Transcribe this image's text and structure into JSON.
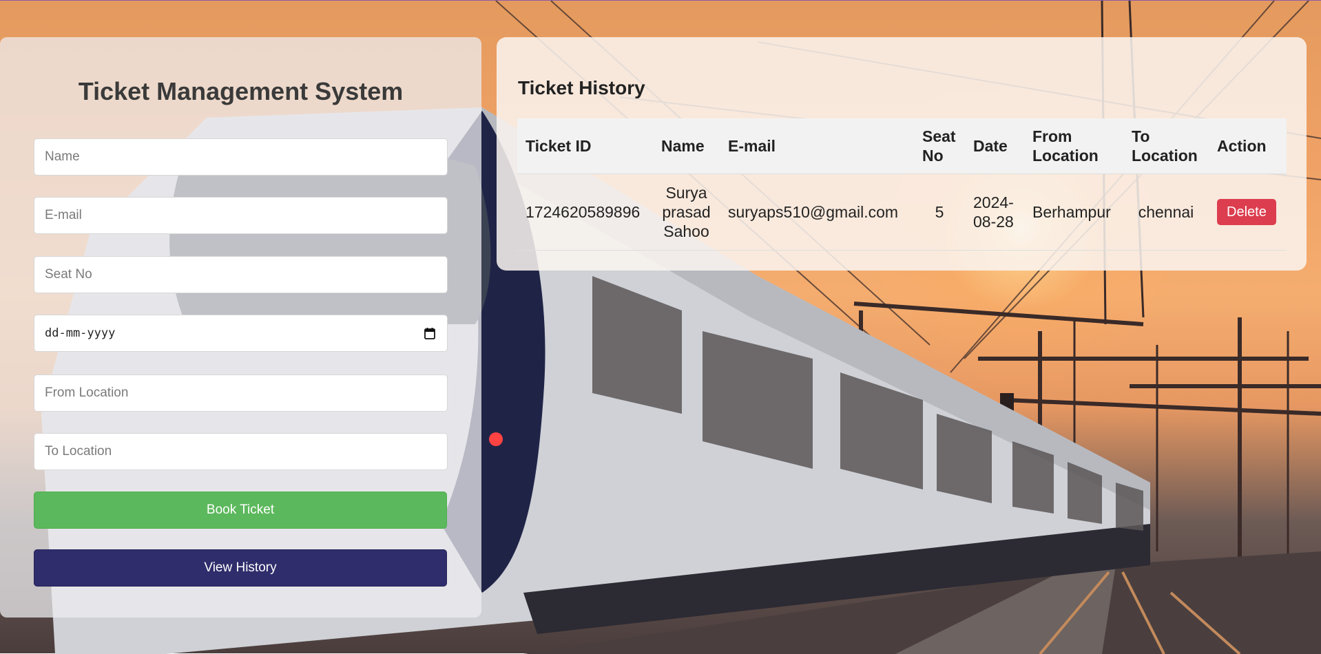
{
  "form": {
    "title": "Ticket Management System",
    "name_placeholder": "Name",
    "email_placeholder": "E-mail",
    "seat_placeholder": "Seat No",
    "date_placeholder": "dd-mm-yyyy",
    "from_placeholder": "From Location",
    "to_placeholder": "To Location",
    "book_label": "Book Ticket",
    "history_label": "View History"
  },
  "history": {
    "title": "Ticket History",
    "columns": {
      "ticket_id": "Ticket ID",
      "name": "Name",
      "email": "E-mail",
      "seat_no": "Seat No",
      "date": "Date",
      "from": "From Location",
      "to": "To Location",
      "action": "Action"
    },
    "rows": [
      {
        "ticket_id": "1724620589896",
        "name": "Surya prasad Sahoo",
        "email": "suryaps510@gmail.com",
        "seat_no": "5",
        "date": "2024-08-28",
        "from": "Berhampur",
        "to": "chennai",
        "action": "Delete"
      }
    ]
  },
  "colors": {
    "book_button": "#5cb85c",
    "history_button": "#2f2d6b",
    "delete_button": "#dc3d4f"
  },
  "icons": {
    "date_picker": "calendar-icon"
  }
}
